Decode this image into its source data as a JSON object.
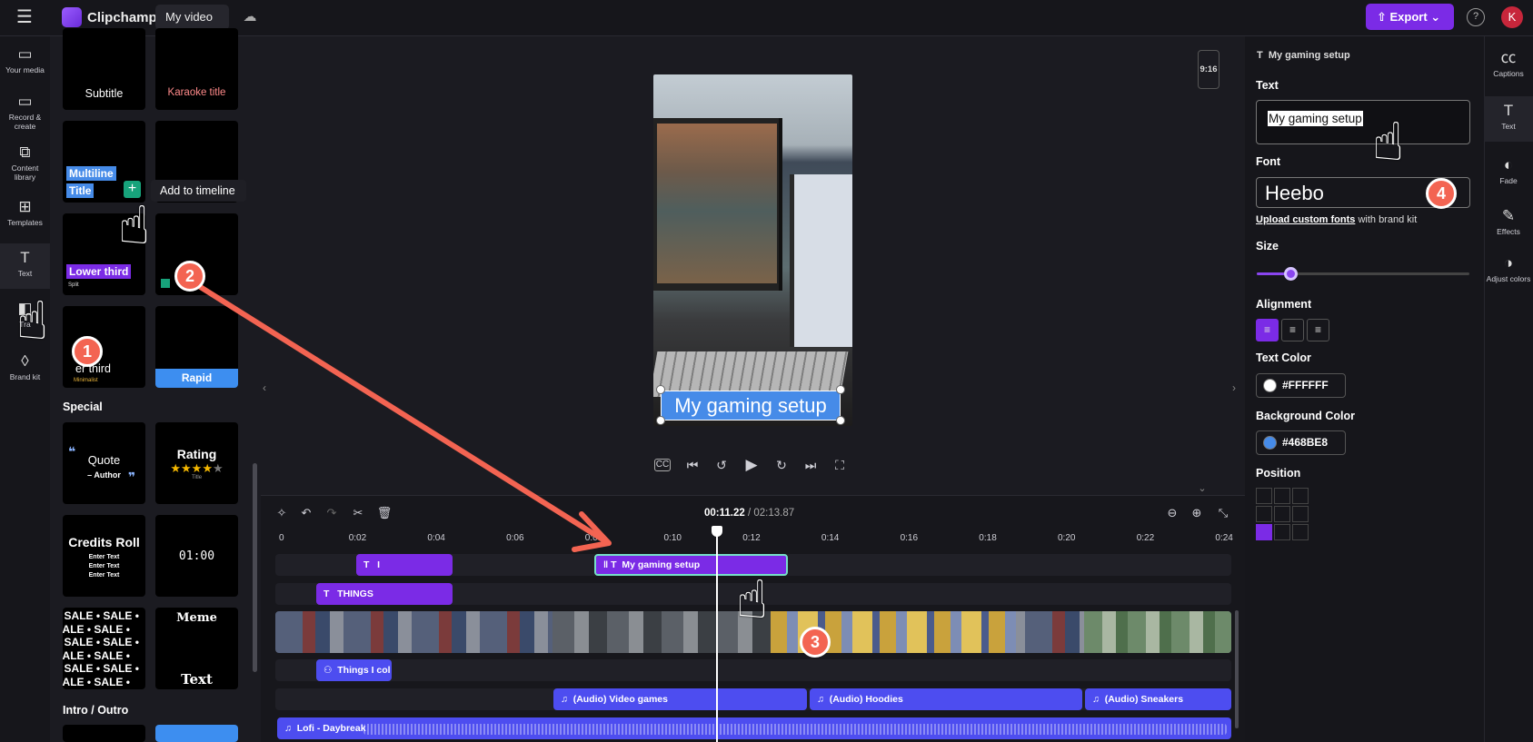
{
  "app": {
    "brand": "Clipchamp",
    "project_name": "My video",
    "export_label": "Export",
    "avatar_initial": "K",
    "accent": "#7B2BE6"
  },
  "left_rail": [
    {
      "label": "Your media",
      "icon": "folder-icon"
    },
    {
      "label": "Record & create",
      "icon": "camera-icon"
    },
    {
      "label": "Content library",
      "icon": "library-icon"
    },
    {
      "label": "Templates",
      "icon": "templates-icon"
    },
    {
      "label": "Text",
      "icon": "text-icon",
      "active": true
    },
    {
      "label": "Tra",
      "icon": "transitions-icon"
    },
    {
      "label": "Brand kit",
      "icon": "brand-kit-icon"
    }
  ],
  "library": {
    "tiles": {
      "subtitle": "Subtitle",
      "karaoke": "Karaoke title",
      "multiline_1": "Multiline",
      "multiline_2": "Title",
      "lower_third": "Lower third",
      "lower_third_sub": "Split",
      "lower_third_2": "er third",
      "minimalist": "Minimalist",
      "rapid": "Rapid",
      "quote": "Quote",
      "quote_author": "– Author",
      "rating": "Rating",
      "rating_sub": "Title",
      "credits": "Credits Roll",
      "credits_line": "Enter Text",
      "countdown": "01:00",
      "sale": "• SALE • SALE •",
      "meme_top": "Meme",
      "meme_bottom": "Text"
    },
    "sections": {
      "special": "Special",
      "intro_outro": "Intro / Outro"
    },
    "tooltip": "Add to timeline"
  },
  "preview": {
    "aspect_ratio": "9:16",
    "caption_text": "My gaming setup",
    "caption_bg": "#468BE8"
  },
  "properties": {
    "title": "My gaming setup",
    "text_label": "Text",
    "text_value": "My gaming setup",
    "font_label": "Font",
    "font_value": "Heebo",
    "upload_link": "Upload custom fonts",
    "upload_suffix": " with brand kit",
    "size_label": "Size",
    "size_value": 0.16,
    "alignment_label": "Alignment",
    "text_color_label": "Text Color",
    "text_color": "#FFFFFF",
    "bg_color_label": "Background Color",
    "bg_color": "#468BE8",
    "position_label": "Position"
  },
  "right_rail": [
    {
      "label": "Captions",
      "icon": "captions-icon"
    },
    {
      "label": "Text",
      "icon": "text-icon",
      "active": true
    },
    {
      "label": "Fade",
      "icon": "fade-icon"
    },
    {
      "label": "Effects",
      "icon": "effects-icon"
    },
    {
      "label": "Adjust colors",
      "icon": "adjust-colors-icon"
    }
  ],
  "timeline": {
    "current_time": "00:11.22",
    "total_time": "/ 02:13.87",
    "ruler": [
      "0",
      "0:02",
      "0:04",
      "0:06",
      "0:08",
      "0:10",
      "0:12",
      "0:14",
      "0:16",
      "0:18",
      "0:20",
      "0:22",
      "0:24"
    ],
    "text_clips": {
      "clip_i": "I",
      "clip_gaming": "My gaming setup",
      "clip_things": "THINGS",
      "clip_things_i": "Things I col"
    },
    "audio_clips": {
      "video_games": "(Audio) Video games",
      "hoodies": "(Audio) Hoodies",
      "sneakers": "(Audio) Sneakers",
      "music": "Lofi - Daybreak"
    }
  },
  "annotations": {
    "step1": "1",
    "step2": "2",
    "step3": "3",
    "step4": "4"
  }
}
